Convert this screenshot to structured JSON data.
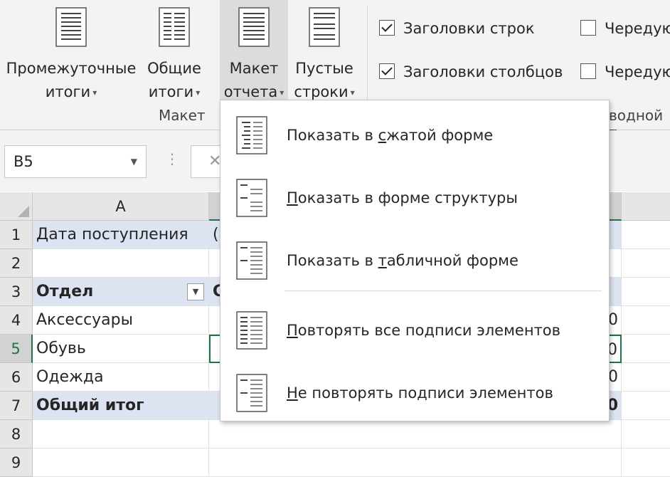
{
  "ribbon": {
    "buttons": [
      {
        "line1": "Промежуточные",
        "line2": "итоги"
      },
      {
        "line1": "Общие",
        "line2": "итоги"
      },
      {
        "line1": "Макет",
        "line2": "отчета"
      },
      {
        "line1": "Пустые",
        "line2": "строки"
      }
    ],
    "group_label": "Макет",
    "options": {
      "row_headers": {
        "label": "Заголовки строк",
        "checked": true
      },
      "col_headers": {
        "label": "Заголовки столбцов",
        "checked": true
      },
      "banded_rows": {
        "label": "Чередую",
        "checked": false
      },
      "banded_cols": {
        "label": "Чередую",
        "checked": false
      }
    },
    "styles_group_label": "водной т"
  },
  "formula_bar": {
    "name_box": "B5",
    "dots": "⋮",
    "cancel": "✕"
  },
  "grid": {
    "col_a": "A",
    "rows": [
      {
        "num": "1",
        "a": "Дата поступления",
        "b": "(",
        "bold": false,
        "fill": true
      },
      {
        "num": "2",
        "a": "",
        "b": "",
        "bold": false,
        "fill": false
      },
      {
        "num": "3",
        "a": "Отдел",
        "b": "С",
        "bold": true,
        "fill": true
      },
      {
        "num": "4",
        "a": "Аксессуары",
        "b": "",
        "right": "0",
        "bold": false,
        "fill": false
      },
      {
        "num": "5",
        "a": "Обувь",
        "b": "",
        "right": "0",
        "bold": false,
        "fill": false
      },
      {
        "num": "6",
        "a": "Одежда",
        "b": "",
        "right": "0",
        "bold": false,
        "fill": false
      },
      {
        "num": "7",
        "a": "Общий итог",
        "b": "",
        "right": "0",
        "bold": true,
        "fill": true
      },
      {
        "num": "8",
        "a": "",
        "b": "",
        "bold": false,
        "fill": false
      },
      {
        "num": "9",
        "a": "",
        "b": "",
        "bold": false,
        "fill": false
      }
    ]
  },
  "menu": {
    "items": [
      {
        "pre": "Показать в ",
        "ul": "с",
        "post": "жатой форме"
      },
      {
        "pre": "",
        "ul": "П",
        "post": "оказать в форме структуры"
      },
      {
        "pre": "Показать в ",
        "ul": "т",
        "post": "абличной форме"
      },
      {
        "pre": "",
        "ul": "П",
        "post": "овторять все подписи элементов"
      },
      {
        "pre": "",
        "ul": "Н",
        "post": "е повторять подписи элементов"
      }
    ]
  },
  "colors": {
    "accent_green": "#217346",
    "pivot_header_fill": "#dce3f1",
    "ribbon_bg": "#f3f3f3"
  }
}
